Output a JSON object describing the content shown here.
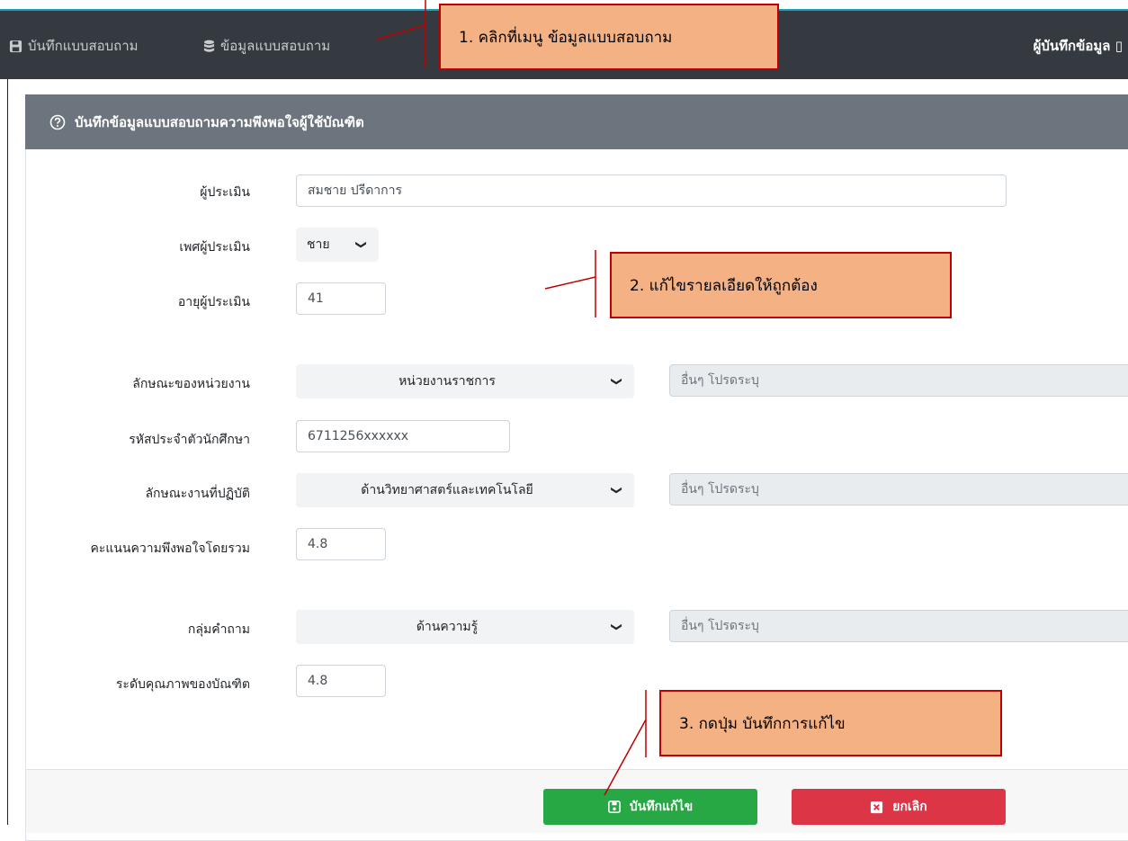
{
  "topbar": {
    "nav_save": "บันทึกแบบสอบถาม",
    "nav_data": "ข้อมูลแบบสอบถาม",
    "user_label": "ผู้บันทึกข้อมูล"
  },
  "card": {
    "title": "บันทึกข้อมูลแบบสอบถามความพึงพอใจผู้ใช้บัณฑิต"
  },
  "form": {
    "evaluator_label": "ผู้ประเมิน",
    "evaluator_value": "สมชาย ปรีดาการ",
    "gender_label": "เพศผู้ประเมิน",
    "gender_value": "ชาย",
    "age_label": "อายุผู้ประเมิน",
    "age_value": "41",
    "org_type_label": "ลักษณะของหน่วยงาน",
    "org_type_value": "หน่วยงานราชการ",
    "org_other_placeholder": "อื่นๆ โปรดระบุ",
    "student_id_label": "รหัสประจำตัวนักศึกษา",
    "student_id_value": "6711256xxxxxx",
    "work_type_label": "ลักษณะงานที่ปฏิบัติ",
    "work_type_value": "ด้านวิทยาศาสตร์และเทคโนโลยี",
    "work_other_placeholder": "อื่นๆ โปรดระบุ",
    "overall_score_label": "คะแนนความพึงพอใจโดยรวม",
    "overall_score_value": "4.8",
    "question_group_label": "กลุ่มคำถาม",
    "question_group_value": "ด้านความรู้",
    "question_other_placeholder": "อื่นๆ โปรดระบุ",
    "quality_label": "ระดับคุณภาพของบัณฑิต",
    "quality_value": "4.8"
  },
  "buttons": {
    "save_edit": "บันทึกแก้ไข",
    "cancel": "ยกเลิก",
    "save_color": "#28a745",
    "cancel_color": "#dc3545"
  },
  "callouts": {
    "step1": "1. คลิกที่เมนู ข้อมูลแบบสอบถาม",
    "step2": "2. แก้ไขรายลเอียดให้ถูกต้อง",
    "step3": "3. กดปุ่ม บันทึกการแก้ไข"
  },
  "icons": [
    "floppy-icon",
    "database-icon",
    "question-circle-icon",
    "chevron-down-icon",
    "close-square-icon"
  ]
}
